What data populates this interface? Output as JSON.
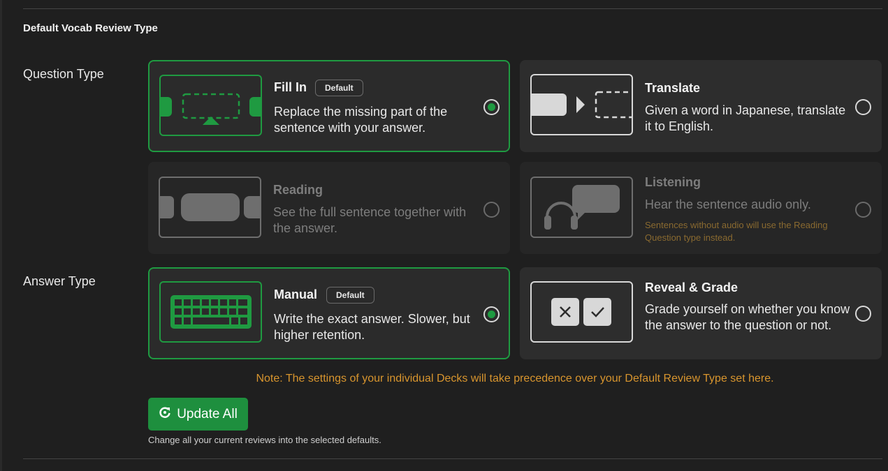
{
  "section": {
    "title": "Default Vocab Review Type"
  },
  "question_type": {
    "label": "Question Type",
    "options": [
      {
        "title": "Fill In",
        "badge": "Default",
        "description": "Replace the missing part of the sentence with your answer.",
        "selected": true,
        "icon": "fill-in-icon"
      },
      {
        "title": "Translate",
        "description": "Given a word in Japanese, translate it to English.",
        "selected": false,
        "icon": "translate-icon"
      },
      {
        "title": "Reading",
        "description": "See the full sentence together with the answer.",
        "selected": false,
        "disabled": true,
        "icon": "reading-icon"
      },
      {
        "title": "Listening",
        "description": "Hear the sentence audio only.",
        "note": "Sentences without audio will use the Reading Question type instead.",
        "selected": false,
        "disabled": true,
        "icon": "headphones-icon"
      }
    ]
  },
  "answer_type": {
    "label": "Answer Type",
    "options": [
      {
        "title": "Manual",
        "badge": "Default",
        "description": "Write the exact answer. Slower, but higher retention.",
        "selected": true,
        "icon": "keyboard-icon"
      },
      {
        "title": "Reveal & Grade",
        "description": "Grade yourself on whether you know the answer to the question or not.",
        "selected": false,
        "icon": "reveal-grade-icon"
      }
    ]
  },
  "note": "Note: The settings of your individual Decks will take precedence over your Default Review Type set here.",
  "update_button": {
    "label": "Update All",
    "icon": "refresh-icon"
  },
  "update_help": "Change all your current reviews into the selected defaults.",
  "colors": {
    "accent": "#1f9a41",
    "warning": "#d8952e",
    "background": "#1f1f1f",
    "card": "#2d2d2d"
  }
}
